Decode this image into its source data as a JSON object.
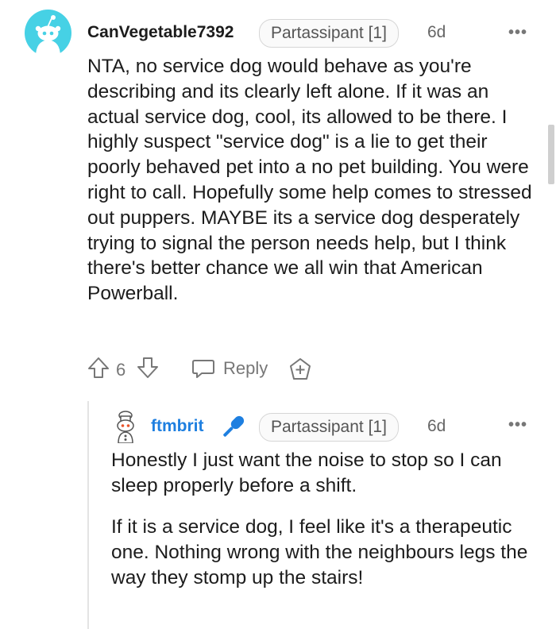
{
  "comment": {
    "username": "CanVegetable7392",
    "flair": "Partassipant [1]",
    "time": "6d",
    "more": "•••",
    "body": "NTA, no service dog would behave as you're describing and its clearly left alone. If it was an actual service dog, cool, its allowed to be there. I highly suspect \"service dog\" is a lie to get their poorly behaved pet into a no pet building. You were right to call. Hopefully some help comes to stressed out puppers. MAYBE its a service dog desperately trying to signal the person needs help, but I think there's better chance we all win that American Powerball.",
    "votes": "6",
    "reply_label": "Reply"
  },
  "reply": {
    "username": "ftmbrit",
    "flair": "Partassipant [1]",
    "time": "6d",
    "more": "•••",
    "paragraphs": [
      "Honestly I just want the noise to stop so I can sleep properly before a shift.",
      "If it is a service dog, I feel like it's a therapeutic one. Nothing wrong with the neighbours legs the way they stomp up the stairs!"
    ]
  },
  "colors": {
    "avatar_bg": "#46d1e5",
    "op_badge": "#1e7fe0",
    "meta_gray": "#777777"
  },
  "icons": [
    "snoo-avatar-icon",
    "upvote-icon",
    "downvote-icon",
    "reply-bubble-icon",
    "award-icon",
    "snoo-chef-avatar-icon",
    "microphone-icon"
  ]
}
